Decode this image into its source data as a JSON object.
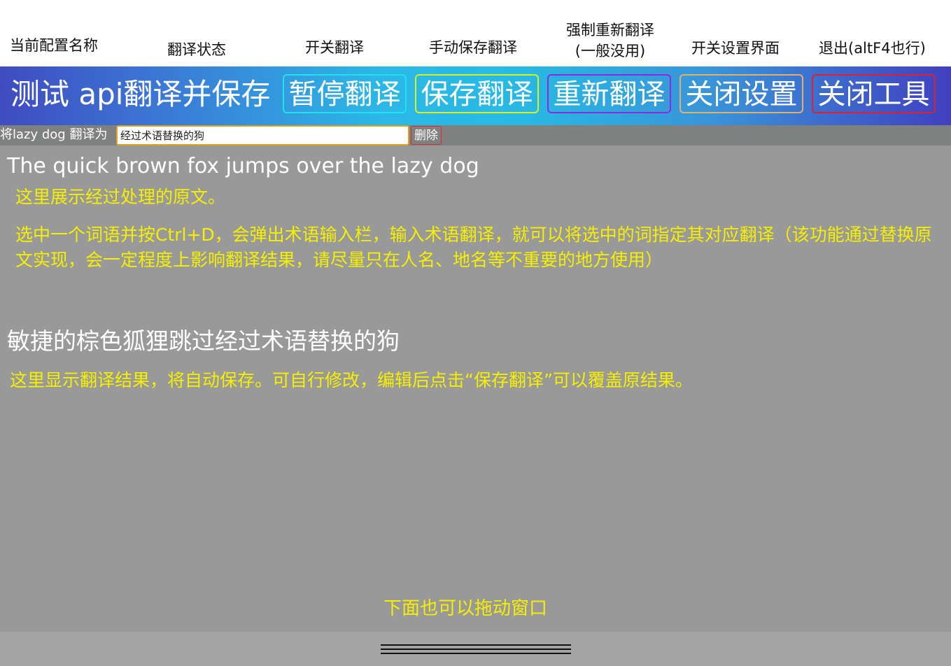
{
  "annotations": {
    "config_name": "当前配置名称",
    "translate_status": "翻译状态",
    "toggle_translate": "开关翻译",
    "manual_save": "手动保存翻译",
    "force_retranslate_line1": "强制重新翻译",
    "force_retranslate_line2": "(一般没用)",
    "toggle_settings": "开关设置界面",
    "exit": "退出(altF4也行)"
  },
  "toolbar": {
    "title": "测试 api翻译并保存",
    "pause_label": "暂停翻译",
    "save_label": "保存翻译",
    "retranslate_label": "重新翻译",
    "close_settings_label": "关闭设置",
    "close_tool_label": "关闭工具",
    "colors": {
      "pause": "#21e0f0",
      "save": "#d8f020",
      "retranslate": "#8a2be2",
      "close_settings": "#e0b070",
      "close_tool": "#e02030"
    }
  },
  "term_row": {
    "label": "将lazy dog 翻译为",
    "value": "经过术语替换的狗",
    "delete_label": "删除"
  },
  "content": {
    "source_text": "The quick brown fox jumps over the lazy dog",
    "source_hint": "这里展示经过处理的原文。",
    "term_hint": "选中一个词语并按Ctrl+D，会弹出术语输入栏，输入术语翻译，就可以将选中的词指定其对应翻译（该功能通过替换原文实现，会一定程度上影响翻译结果，请尽量只在人名、地名等不重要的地方使用）",
    "translation_text": "敏捷的棕色狐狸跳过经过术语替换的狗",
    "translation_hint": "这里显示翻译结果，将自动保存。可自行修改，编辑后点击“保存翻译”可以覆盖原结果。",
    "drag_hint": "下面也可以拖动窗口"
  }
}
